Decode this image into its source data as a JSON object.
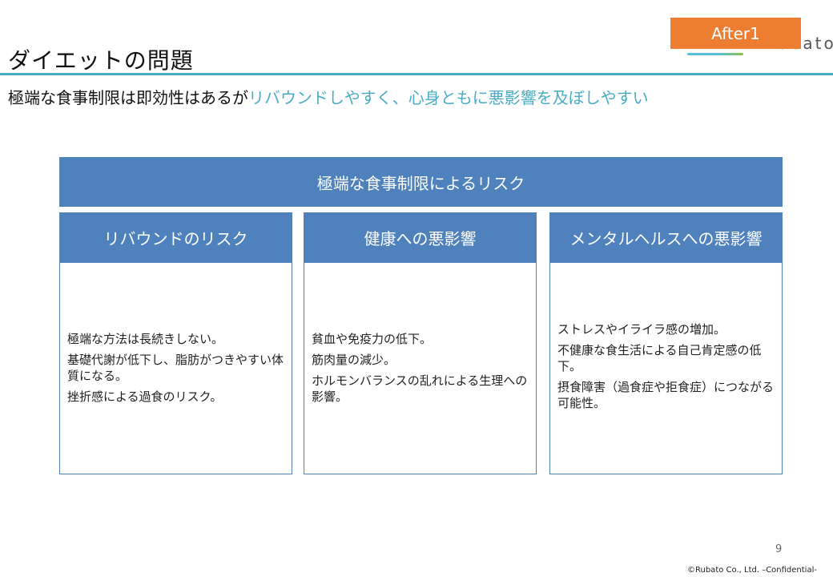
{
  "slide": {
    "title": "ダイエットの問題",
    "badge": "After1",
    "logo": "Rubato",
    "subtitle_plain": "極端な食事制限は即効性はあるが",
    "subtitle_highlight": "リバウンドしやすく、心身ともに悪影響を及ぼしやすい",
    "header": "極端な食事制限によるリスク",
    "columns": [
      {
        "heading": "リバウンドのリスク",
        "items": [
          "極端な方法は長続きしない。",
          "基礎代謝が低下し、脂肪がつきやすい体質になる。",
          "挫折感による過食のリスク。"
        ]
      },
      {
        "heading": "健康への悪影響",
        "items": [
          "貧血や免疫力の低下。",
          "筋肉量の減少。",
          "ホルモンバランスの乱れによる生理への影響。"
        ]
      },
      {
        "heading": "メンタルヘルスへの悪影響",
        "items": [
          "ストレスやイライラ感の増加。",
          "不健康な食生活による自己肯定感の低下。",
          "摂食障害（過食症や拒食症）につながる可能性。"
        ]
      }
    ],
    "page_number": "9",
    "copyright": "©Rubato Co., Ltd. –Confidential-"
  },
  "colors": {
    "accent": "#4BACC6",
    "box": "#4F81BD",
    "badge": "#ED7D31"
  }
}
